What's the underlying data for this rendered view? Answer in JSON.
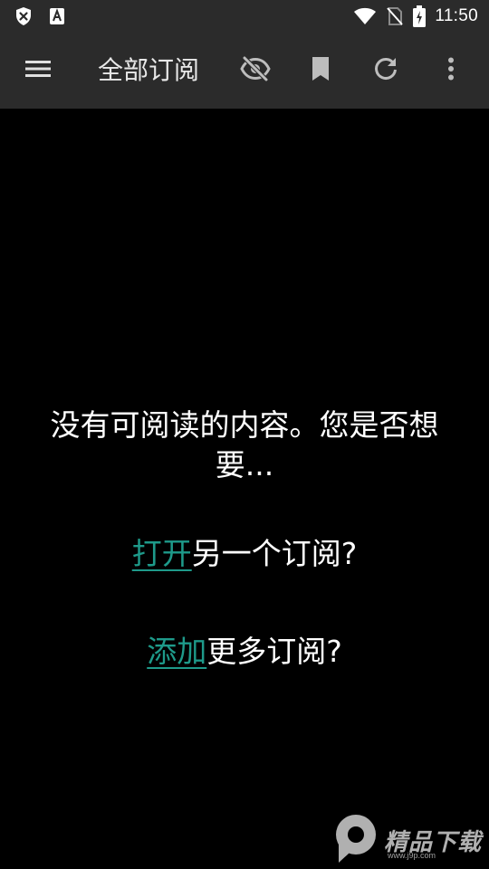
{
  "status_bar": {
    "time": "11:50",
    "icons_left": [
      "shield-x-icon",
      "font-a-icon"
    ],
    "icons_right": [
      "wifi-icon",
      "no-sim-icon",
      "battery-charging-icon"
    ]
  },
  "toolbar": {
    "title": "全部订阅",
    "actions": [
      "menu-icon",
      "eye-off-icon",
      "bookmark-icon",
      "refresh-icon",
      "more-vert-icon"
    ]
  },
  "empty_state": {
    "message": "没有可阅读的内容。您是否想要...",
    "option_open_link": "打开",
    "option_open_rest": "另一个订阅?",
    "option_add_link": "添加",
    "option_add_rest": "更多订阅?"
  },
  "watermark": {
    "text": "精品下载",
    "sub": "www.j9p.com"
  },
  "colors": {
    "background": "#000000",
    "bar": "#2b2b2b",
    "accent": "#1e9a8a",
    "icon": "#bdbdbd"
  }
}
